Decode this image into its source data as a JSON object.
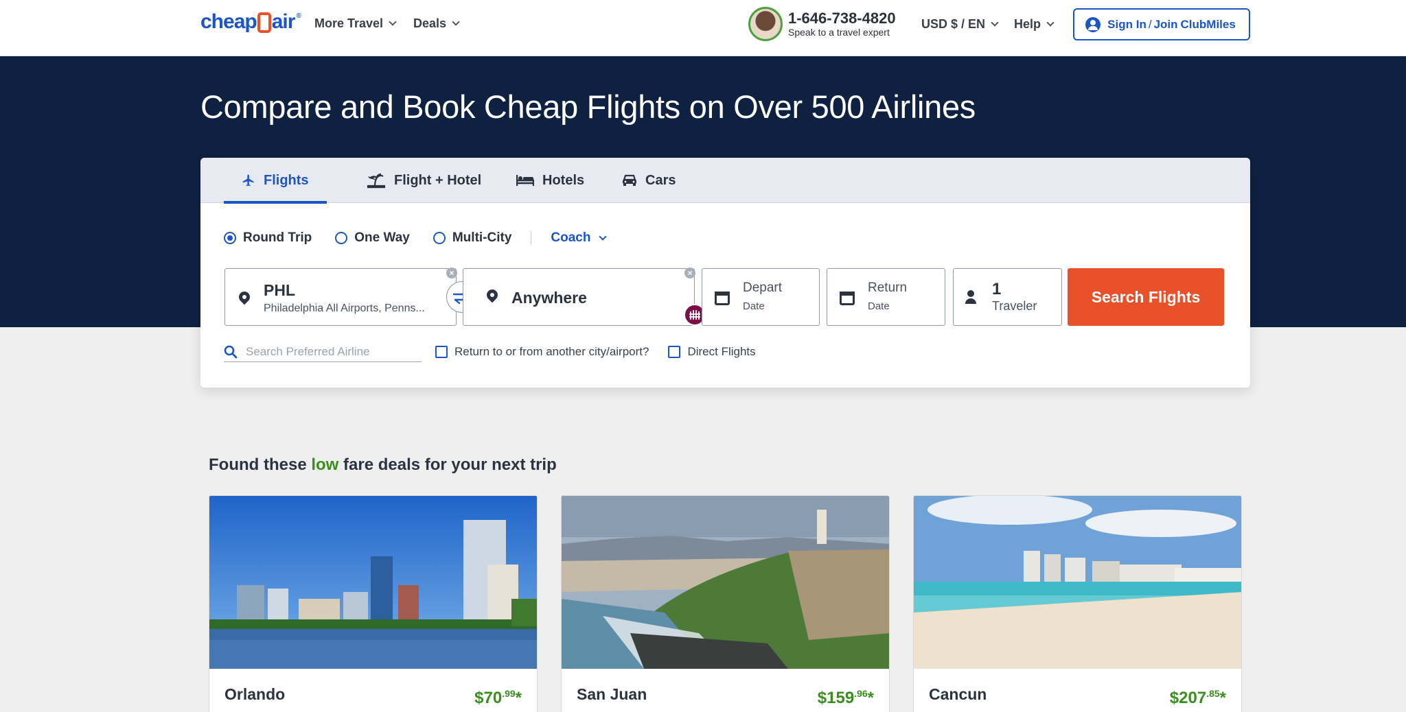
{
  "header": {
    "logo_text_a": "cheap",
    "logo_text_b": "air",
    "logo_reg": "®",
    "nav": [
      "More Travel",
      "Deals"
    ],
    "phone": "1-646-738-4820",
    "phone_sub": "Speak to a travel expert",
    "currency": "USD $ / EN",
    "help": "Help",
    "signin": {
      "sign_in": "Sign In",
      "slash": "/",
      "join": "Join",
      "club": "ClubMiles"
    }
  },
  "hero": {
    "title": "Compare and Book Cheap Flights on Over 500 Airlines"
  },
  "search": {
    "tabs": [
      {
        "label": "Flights",
        "icon": "plane-icon",
        "active": true
      },
      {
        "label": "Flight + Hotel",
        "icon": "palm-plane-icon",
        "active": false
      },
      {
        "label": "Hotels",
        "icon": "bed-icon",
        "active": false
      },
      {
        "label": "Cars",
        "icon": "car-icon",
        "active": false
      }
    ],
    "trip_types": [
      {
        "label": "Round Trip",
        "selected": true
      },
      {
        "label": "One Way",
        "selected": false
      },
      {
        "label": "Multi-City",
        "selected": false
      }
    ],
    "cabin": "Coach",
    "origin": {
      "code": "PHL",
      "name": "Philadelphia All Airports, Penns..."
    },
    "destination": {
      "value": "Anywhere"
    },
    "depart": {
      "top": "Depart",
      "bottom": "Date"
    },
    "return": {
      "top": "Return",
      "bottom": "Date"
    },
    "travelers": {
      "count": "1",
      "label": "Traveler"
    },
    "search_button": "Search Flights",
    "airline_placeholder": "Search Preferred Airline",
    "return_other": "Return to or from another city/airport?",
    "direct": "Direct Flights"
  },
  "deals": {
    "title_a": "Found these",
    "title_low": "low",
    "title_b": "fare deals for your next trip",
    "items": [
      {
        "city": "Orlando",
        "price_main": "$70",
        "price_cents": ".99",
        "asterisk": "*"
      },
      {
        "city": "San Juan",
        "price_main": "$159",
        "price_cents": ".96",
        "asterisk": "*"
      },
      {
        "city": "Cancun",
        "price_main": "$207",
        "price_cents": ".85",
        "asterisk": "*"
      }
    ]
  },
  "colors": {
    "brand_blue": "#1a56c7",
    "accent_orange": "#e9512b",
    "hero_navy": "#0e2140",
    "deal_green": "#3a8f1f"
  }
}
